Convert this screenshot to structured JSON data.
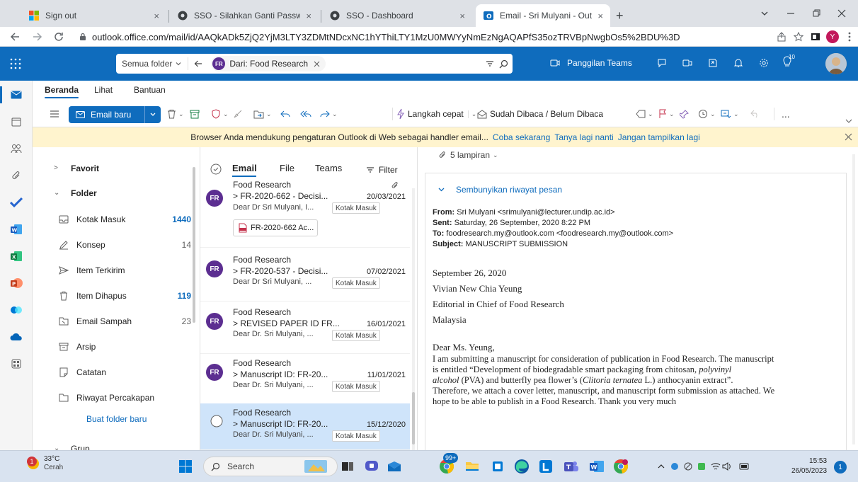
{
  "tabs": [
    {
      "title": "Sign out",
      "close": "×"
    },
    {
      "title": "SSO - Silahkan Ganti Password",
      "close": "×"
    },
    {
      "title": "SSO - Dashboard",
      "close": "×"
    },
    {
      "title": "Email - Sri Mulyani - Outlook",
      "close": "×"
    }
  ],
  "new_tab": "+",
  "url": "outlook.office.com/mail/id/AAQkADk5ZjQ2YjM3LTY3ZDMtNDcxNC1hYThiLTY1MzU0MWYyNmEzNgAQAPfS35ozTRVBpNwgbOs5%2BDU%3D",
  "profile_initial": "Y",
  "header": {
    "scope": "Semua folder",
    "search_avatar": "FR",
    "search_chip": "Dari: Food Research",
    "teams_call": "Panggilan Teams",
    "tips_count": "10"
  },
  "ribbon_tabs": [
    "Beranda",
    "Lihat",
    "Bantuan"
  ],
  "ribbon": {
    "new_mail": "Email baru",
    "quick_steps": "Langkah cepat",
    "read_unread": "Sudah Dibaca / Belum Dibaca",
    "more": "..."
  },
  "notification": {
    "text": "Browser Anda mendukung pengaturan Outlook di Web sebagai handler email...",
    "try": "Coba sekarang",
    "later": "Tanya lagi nanti",
    "never": "Jangan tampilkan lagi"
  },
  "folders": {
    "favorites": "Favorit",
    "folder_header": "Folder",
    "items": [
      {
        "name": "Kotak Masuk",
        "count": "1440"
      },
      {
        "name": "Konsep",
        "count": "14"
      },
      {
        "name": "Item Terkirim",
        "count": ""
      },
      {
        "name": "Item Dihapus",
        "count": "119"
      },
      {
        "name": "Email Sampah",
        "count": "23"
      },
      {
        "name": "Arsip",
        "count": ""
      },
      {
        "name": "Catatan",
        "count": ""
      },
      {
        "name": "Riwayat Percakapan",
        "count": ""
      }
    ],
    "new_folder": "Buat folder baru",
    "group": "Grup"
  },
  "list": {
    "tabs": [
      "Email",
      "File",
      "Teams"
    ],
    "filter": "Filter",
    "messages": [
      {
        "avatar": "FR",
        "from": "Food Research",
        "subject": "> FR-2020-662 - Decisi...",
        "date": "20/03/2021",
        "preview": "Dear Dr Sri Mulyani, I...",
        "badge": "Kotak Masuk",
        "attachment": "FR-2020-662 Ac..."
      },
      {
        "avatar": "FR",
        "from": "Food Research",
        "subject": "> FR-2020-537 - Decisi...",
        "date": "07/02/2021",
        "preview": "Dear Dr Sri Mulyani, ...",
        "badge": "Kotak Masuk"
      },
      {
        "avatar": "FR",
        "from": "Food Research",
        "subject": "> REVISED PAPER ID FR...",
        "date": "16/01/2021",
        "preview": "Dear Dr. Sri Mulyani, ...",
        "badge": "Kotak Masuk"
      },
      {
        "avatar": "FR",
        "from": "Food Research",
        "subject": "> Manuscript ID: FR-20...",
        "date": "11/01/2021",
        "preview": "Dear Dr. Sri Mulyani, ...",
        "badge": "Kotak Masuk"
      },
      {
        "avatar": "",
        "from": "Food Research",
        "subject": "> Manuscript ID: FR-20...",
        "date": "15/12/2020",
        "preview": "Dear Dr. Sri Mulyani, ...",
        "badge": "Kotak Masuk"
      }
    ]
  },
  "reading": {
    "attachments": "5 lampiran",
    "hide_history": "Sembunyikan riwayat pesan",
    "from_label": "From:",
    "from_value": "Sri Mulyani <srimulyani@lecturer.undip.ac.id>",
    "sent_label": "Sent:",
    "sent_value": "Saturday, 26 September, 2020 8:22 PM",
    "to_label": "To:",
    "to_value": "foodresearch.my@outlook.com <foodresearch.my@outlook.com>",
    "subject_label": "Subject:",
    "subject_value": "MANUSCRIPT SUBMISSION",
    "date": "September 26, 2020",
    "addr1": "Vivian New Chia Yeung",
    "addr2": "Editorial in Chief of Food Research",
    "addr3": "Malaysia",
    "greeting": "Dear Ms. Yeung,",
    "p1": "I am submitting a manuscript for consideration of publication in Food Research. The manuscript",
    "p2a": "is entitled “Development of biodegradable smart packaging from chitosan, ",
    "p2b": "polyvinyl",
    "p3a": "alcohol",
    "p3b": " (PVA) and butterfly pea flower’s (",
    "p3c": "Clitoria ternatea",
    "p3d": " L.) anthocyanin extract”.",
    "p4": "Therefore, we attach a cover letter, manuscript, and manuscript form submission as attached. We",
    "p5": "hope to be able to publish  in a Food Research. Thank you very much"
  },
  "taskbar": {
    "weather_temp": "33°C",
    "weather_desc": "Cerah",
    "weather_badge": "1",
    "search": "Search",
    "chrome_badge": "99+",
    "time": "15:53",
    "date": "26/05/2023",
    "notif_count": "1"
  }
}
